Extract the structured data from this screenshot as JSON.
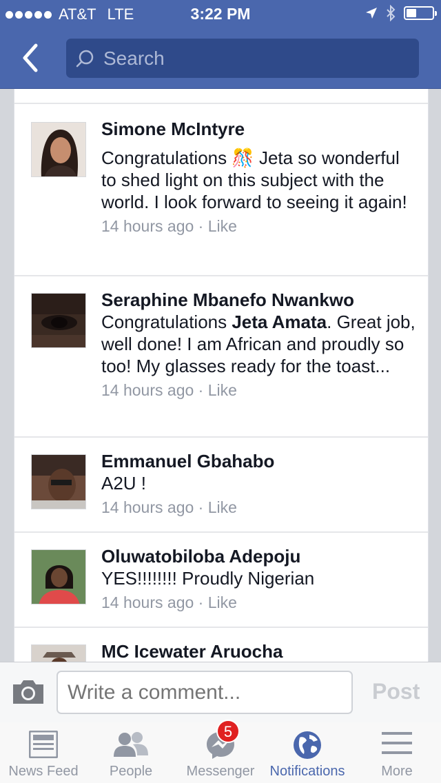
{
  "status_bar": {
    "carrier": "AT&T",
    "network": "LTE",
    "time": "3:22 PM"
  },
  "search": {
    "placeholder": "Search"
  },
  "comments": [
    {
      "name": "Simone McIntyre",
      "text_before": "Congratulations ",
      "emoji": "🎊",
      "text_after": " Jeta so wonderful to shed light on this subject with the world.  I look forward to seeing it again!",
      "time": "14 hours ago",
      "sep": "·",
      "like": "Like"
    },
    {
      "name": "Seraphine Mbanefo Nwankwo",
      "text_before": "Congratulations ",
      "mention": "Jeta Amata",
      "text_after": ". Great job, well done! I am African and proudly so too! My glasses ready for the toast...",
      "time": "14 hours ago",
      "sep": "·",
      "like": "Like"
    },
    {
      "name": "Emmanuel Gbahabo",
      "text": "A2U !",
      "time": "14 hours ago",
      "sep": "·",
      "like": "Like"
    },
    {
      "name": "Oluwatobiloba Adepoju",
      "text": "YES!!!!!!!! Proudly Nigerian",
      "time": "14 hours ago",
      "sep": "·",
      "like": "Like"
    },
    {
      "name": "MC Icewater Aruocha"
    }
  ],
  "composer": {
    "placeholder": "Write a comment...",
    "post_label": "Post"
  },
  "tabs": [
    {
      "label": "News Feed",
      "icon": "news-feed-icon"
    },
    {
      "label": "People",
      "icon": "people-icon"
    },
    {
      "label": "Messenger",
      "icon": "messenger-icon",
      "badge": "5"
    },
    {
      "label": "Notifications",
      "icon": "globe-icon",
      "active": true
    },
    {
      "label": "More",
      "icon": "menu-icon"
    }
  ],
  "colors": {
    "header": "#4a67ad",
    "active_tab": "#4a67ad",
    "badge": "#e02121"
  }
}
